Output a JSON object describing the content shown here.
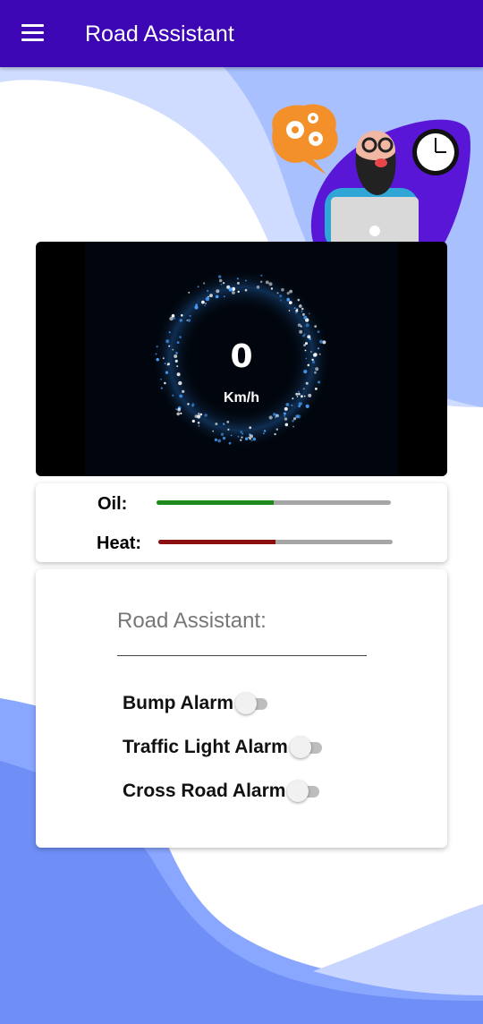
{
  "appbar": {
    "title": "Road Assistant",
    "menu_icon": "hamburger-menu-icon",
    "color": "#3d06b4"
  },
  "speedometer": {
    "value": "0",
    "unit": "Km/h",
    "ring_color": "#4aa3ff"
  },
  "levels": {
    "oil": {
      "label": "Oil:",
      "fraction": 0.5,
      "color": "#1e8a1e"
    },
    "heat": {
      "label": "Heat:",
      "fraction": 0.5,
      "color": "#8b0f0f"
    }
  },
  "alarms": {
    "title": "Road Assistant:",
    "items": [
      {
        "label": "Bump Alarm",
        "enabled": false
      },
      {
        "label": "Traffic Light Alarm",
        "enabled": false
      },
      {
        "label": "Cross Road Alarm",
        "enabled": false
      }
    ]
  }
}
